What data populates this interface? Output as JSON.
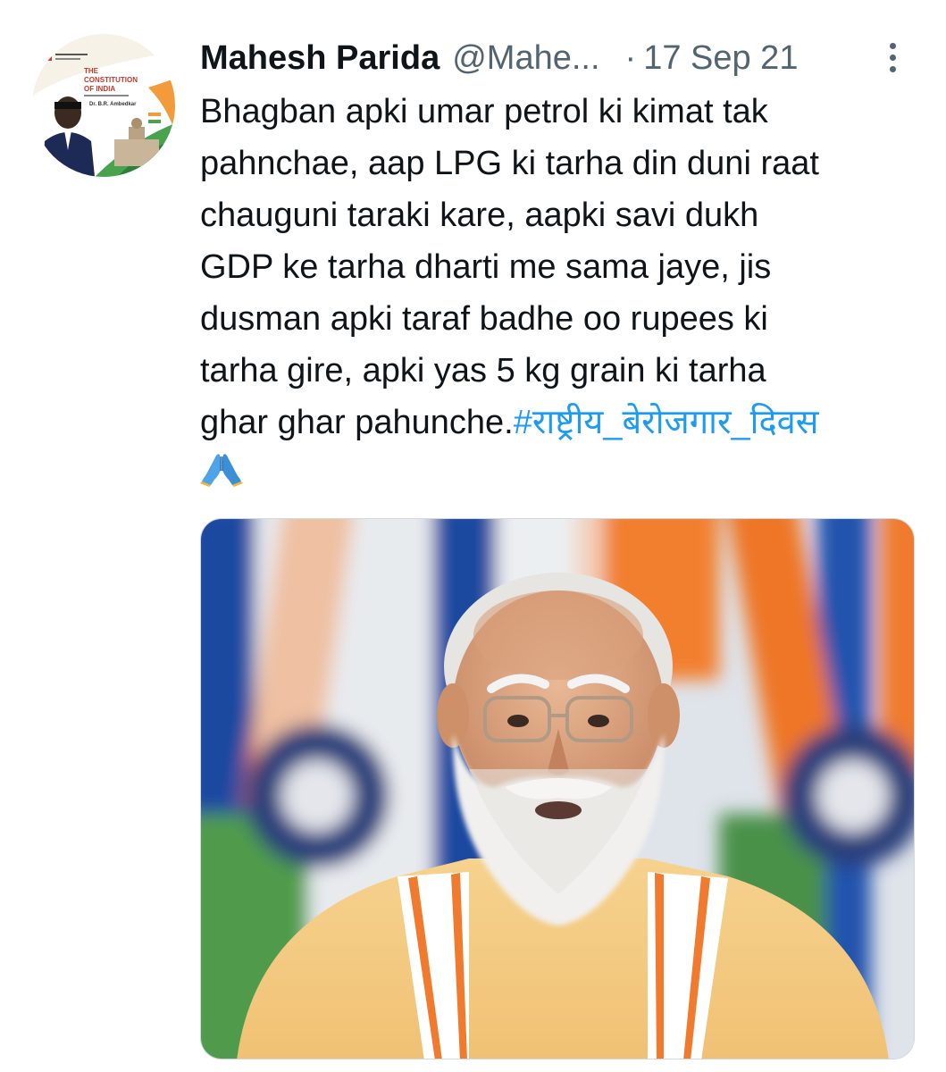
{
  "tweet": {
    "author": {
      "display_name": "Mahesh Parida",
      "handle": "@Mahe..."
    },
    "separator": "·",
    "date": "17 Sep 21",
    "text": "Bhagban apki umar petrol ki kimat tak\npahnchae, aap LPG ki tarha din duni raat\nchauguni taraki kare, aapki savi dukh\nGDP ke tarha dharti me sama jaye, jis\ndusman apki taraf badhe oo rupees ki\ntarha gire, apki yas 5 kg grain ki tarha\nghar ghar pahunche.",
    "hashtag": "#राष्ट्रीय_बेरोजगार_दिवस",
    "emoji": "folded-hands-emoji"
  },
  "avatar": {
    "book_title_line1": "THE",
    "book_title_line2": "CONSTITUTION",
    "book_title_line3": "OF INDIA",
    "book_author": "Dr. B.R. Ambedkar"
  },
  "colors": {
    "hashtag": "#1d9bf0",
    "secondary_text": "#536471",
    "saffron": "#f07a2e",
    "green": "#3f9a4a",
    "navy": "#1f3d8f"
  }
}
